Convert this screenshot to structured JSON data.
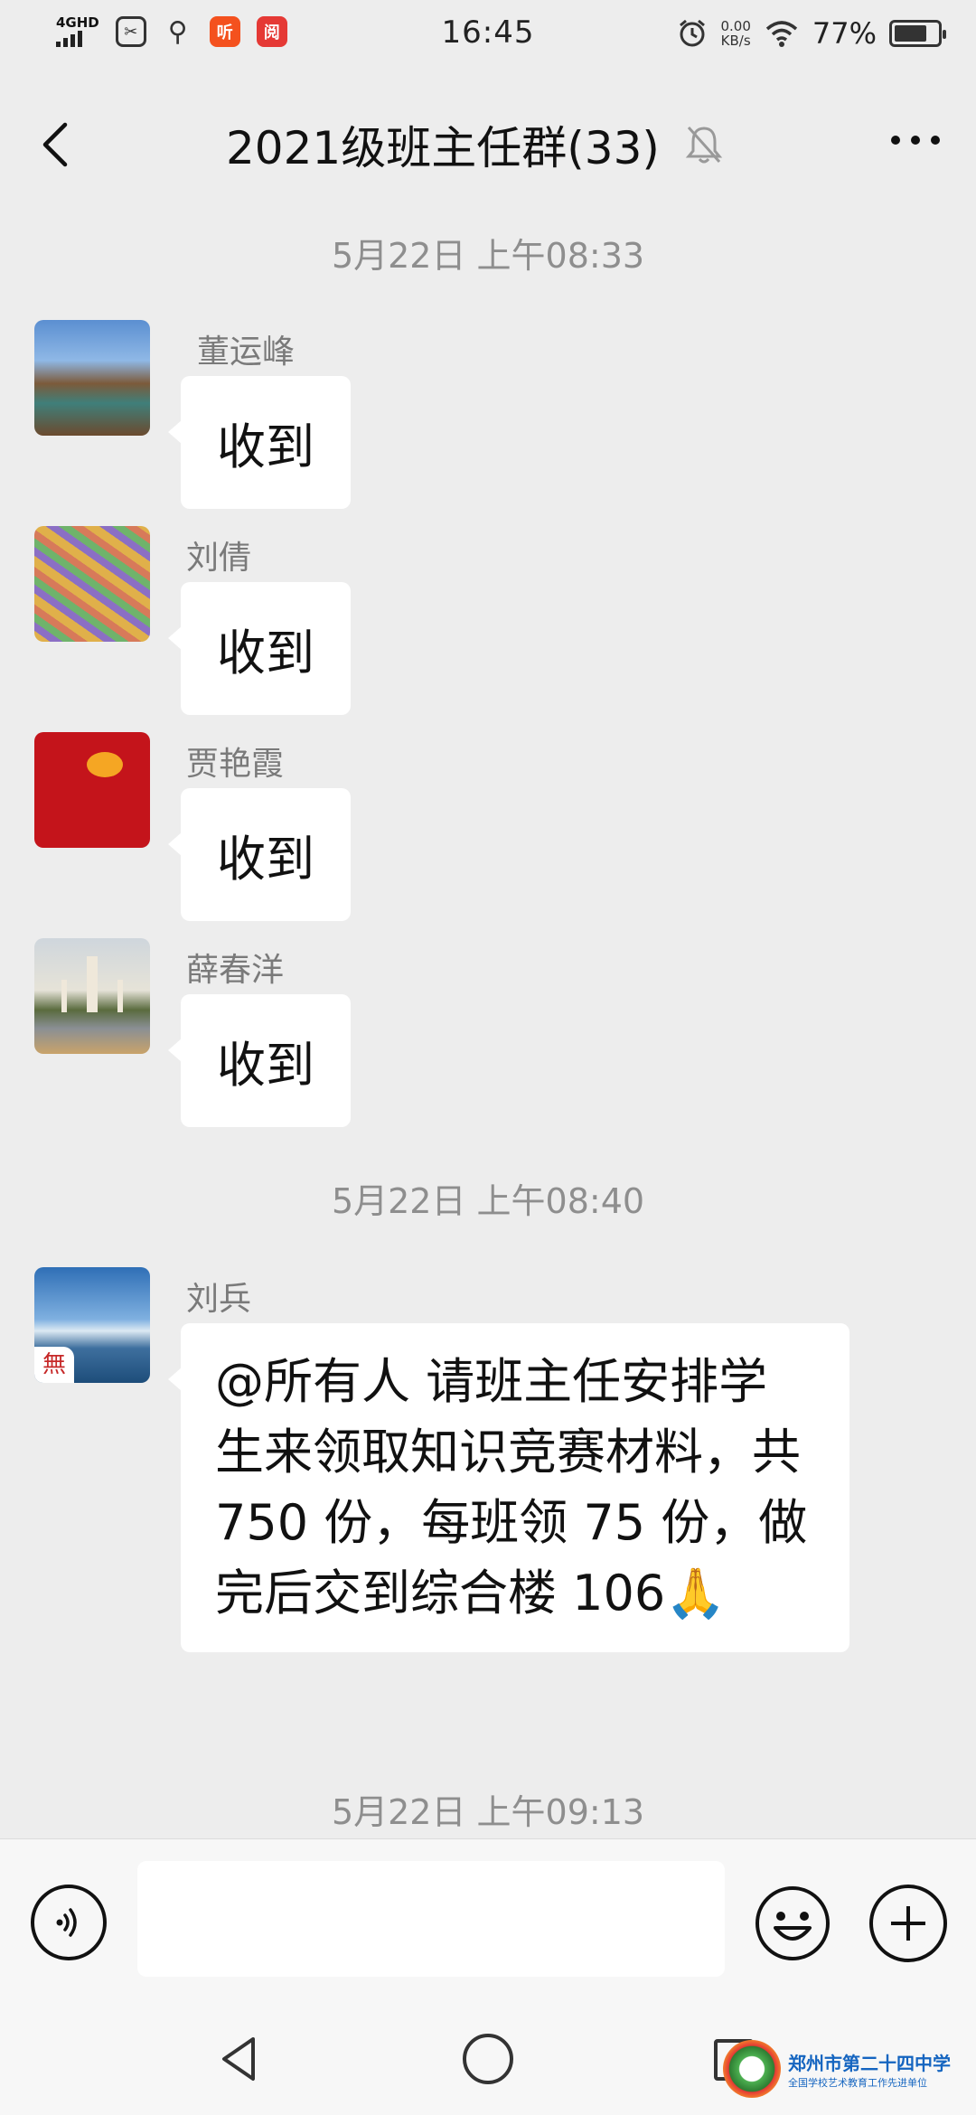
{
  "status_bar": {
    "network": "4GHD",
    "app_icons": [
      "scissors-icon",
      "location-icon",
      "ting-icon",
      "red-app-icon"
    ],
    "ting_label": "听",
    "red_label": "阅",
    "time": "16:45",
    "speed_value": "0.00",
    "speed_unit": "KB/s",
    "battery": "77%",
    "battery_level": 0.77
  },
  "nav": {
    "title": "2021级班主任群(33)"
  },
  "chat": {
    "timestamps": [
      "5月22日 上午08:33",
      "5月22日 上午08:40",
      "5月22日 上午09:13"
    ],
    "messages": [
      {
        "sender": "董运峰",
        "text": "收到"
      },
      {
        "sender": "刘倩",
        "text": "收到"
      },
      {
        "sender": "贾艳霞",
        "text": "收到"
      },
      {
        "sender": "薛春洋",
        "text": "收到"
      },
      {
        "sender": "刘兵",
        "text": "@所有人  请班主任安排学生来领取知识竞赛材料，共 750 份，每班领 75 份，做完后交到综合楼 106🙏"
      }
    ]
  },
  "input": {
    "placeholder": ""
  },
  "watermark": {
    "title": "郑州市第二十四中学",
    "subtitle": "全国学校艺术教育工作先进单位"
  },
  "colors": {
    "background": "#ededed",
    "bubble": "#ffffff",
    "timestamp": "#8e8e8e"
  }
}
